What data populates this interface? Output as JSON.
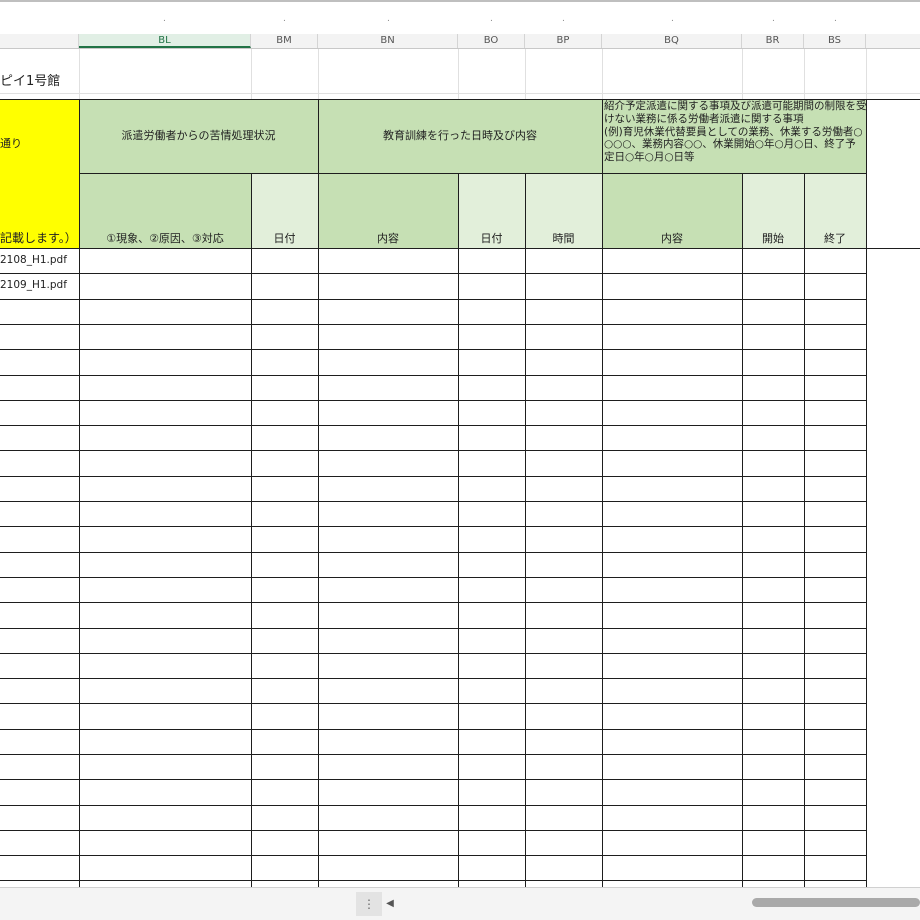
{
  "columns": [
    {
      "letter": "BL",
      "selected": true
    },
    {
      "letter": "BM",
      "selected": false
    },
    {
      "letter": "BN",
      "selected": false
    },
    {
      "letter": "BO",
      "selected": false
    },
    {
      "letter": "BP",
      "selected": false
    },
    {
      "letter": "BQ",
      "selected": false
    },
    {
      "letter": "BR",
      "selected": false
    },
    {
      "letter": "BS",
      "selected": false
    }
  ],
  "top_dots": [
    ".",
    ".",
    ".",
    ".",
    ".",
    ".",
    ".",
    "."
  ],
  "sheet": {
    "building_name": "ピイ1号館",
    "partial_header_top": "通り",
    "partial_header_bottom": "記載します。）",
    "group_headers": {
      "complaints": "派遣労働者からの苦情処理状況",
      "training": "教育訓練を行った日時及び内容",
      "special_duties": [
        "紹介予定派遣に関する事項及び派遣可能期間の制限を受",
        "けない業務に係る労働者派遣に関する事項",
        "(例)育児休業代替要員としての業務、休業する労働者○",
        "○○○、業務内容○○、休業開始○年○月○日、終了予",
        "定日○年○月○日等"
      ]
    },
    "sub_headers": {
      "complaint_detail": "①現象、②原因、③対応",
      "complaint_date": "日付",
      "training_content": "内容",
      "training_date": "日付",
      "training_time": "時間",
      "special_content": "内容",
      "special_start": "開始",
      "special_end": "終了"
    },
    "file_rows": [
      "2108_H1.pdf",
      "2109_H1.pdf"
    ]
  },
  "colors": {
    "yellow": "#ffff00",
    "header_green": "#c6e0b4",
    "light_green": "#e2efda",
    "accent": "#217346"
  },
  "icons": {
    "sheet_options": "vertical-ellipsis-icon",
    "scroll_left": "triangle-left-icon"
  }
}
